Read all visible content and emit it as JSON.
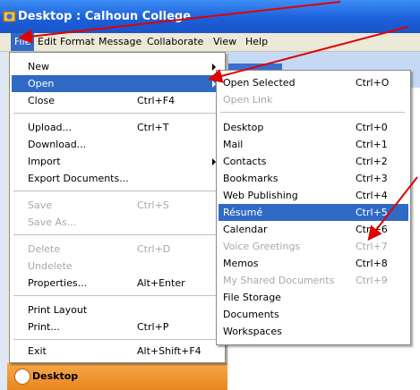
{
  "window": {
    "title": "Desktop : Calhoun College"
  },
  "menubar": {
    "items": [
      {
        "label": "File",
        "active": true
      },
      {
        "label": "Edit"
      },
      {
        "label": "Format"
      },
      {
        "label": "Message"
      },
      {
        "label": "Collaborate"
      },
      {
        "label": "View"
      },
      {
        "label": "Help"
      }
    ]
  },
  "file_menu": {
    "items": [
      {
        "label": "New",
        "shortcut": "",
        "submenu": true
      },
      {
        "label": "Open",
        "shortcut": "",
        "submenu": true,
        "selected": true
      },
      {
        "label": "Close",
        "shortcut": "Ctrl+F4"
      },
      {
        "label": "Upload...",
        "shortcut": "Ctrl+T"
      },
      {
        "label": "Download...",
        "shortcut": ""
      },
      {
        "label": "Import",
        "shortcut": "",
        "submenu": true
      },
      {
        "label": "Export Documents...",
        "shortcut": ""
      },
      {
        "label": "Save",
        "shortcut": "Ctrl+S",
        "disabled": true
      },
      {
        "label": "Save As...",
        "shortcut": "",
        "disabled": true
      },
      {
        "label": "Delete",
        "shortcut": "Ctrl+D",
        "disabled": true
      },
      {
        "label": "Undelete",
        "shortcut": "",
        "disabled": true
      },
      {
        "label": "Properties...",
        "shortcut": "Alt+Enter"
      },
      {
        "label": "Print Layout",
        "shortcut": ""
      },
      {
        "label": "Print...",
        "shortcut": "Ctrl+P"
      },
      {
        "label": "Exit",
        "shortcut": "Alt+Shift+F4"
      }
    ]
  },
  "open_menu": {
    "items": [
      {
        "label": "Open Selected",
        "shortcut": "Ctrl+O"
      },
      {
        "label": "Open Link",
        "shortcut": "",
        "disabled": true
      },
      {
        "label": "Desktop",
        "shortcut": "Ctrl+0"
      },
      {
        "label": "Mail",
        "shortcut": "Ctrl+1"
      },
      {
        "label": "Contacts",
        "shortcut": "Ctrl+2"
      },
      {
        "label": "Bookmarks",
        "shortcut": "Ctrl+3"
      },
      {
        "label": "Web Publishing",
        "shortcut": "Ctrl+4"
      },
      {
        "label": "Résumé",
        "shortcut": "Ctrl+5",
        "selected": true
      },
      {
        "label": "Calendar",
        "shortcut": "Ctrl+6"
      },
      {
        "label": "Voice Greetings",
        "shortcut": "Ctrl+7",
        "disabled": true
      },
      {
        "label": "Memos",
        "shortcut": "Ctrl+8"
      },
      {
        "label": "My Shared Documents",
        "shortcut": "Ctrl+9",
        "disabled": true
      },
      {
        "label": "File Storage",
        "shortcut": ""
      },
      {
        "label": "Documents",
        "shortcut": ""
      },
      {
        "label": "Workspaces",
        "shortcut": ""
      }
    ]
  },
  "side_panel": {
    "label": "Desktop"
  },
  "colors": {
    "accent": "#316ac5",
    "titlebar": "#1c5fd9",
    "annotation_arrow": "#e00000"
  }
}
